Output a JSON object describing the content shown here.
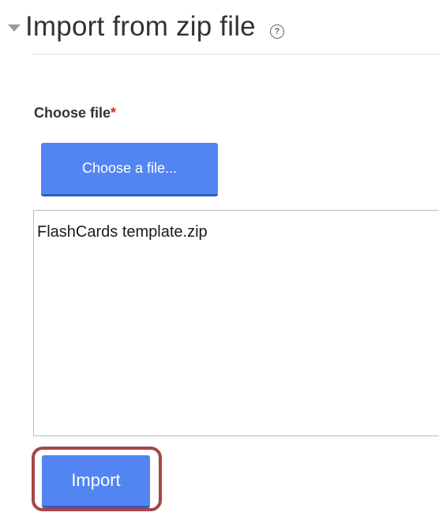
{
  "section": {
    "title": "Import from zip file",
    "help_icon": "question-circle-icon",
    "toggle_icon": "triangle-down-icon"
  },
  "form": {
    "field_label": "Choose file",
    "required_marker": "*",
    "choose_button_label": "Choose a file...",
    "selected_files": [
      "FlashCards template.zip"
    ],
    "import_button_label": "Import"
  },
  "colors": {
    "button": "#5285f2",
    "button_border": "#2f5cc2",
    "required": "#e11f1f",
    "highlight": "#a84447",
    "divider": "#dddddd"
  }
}
